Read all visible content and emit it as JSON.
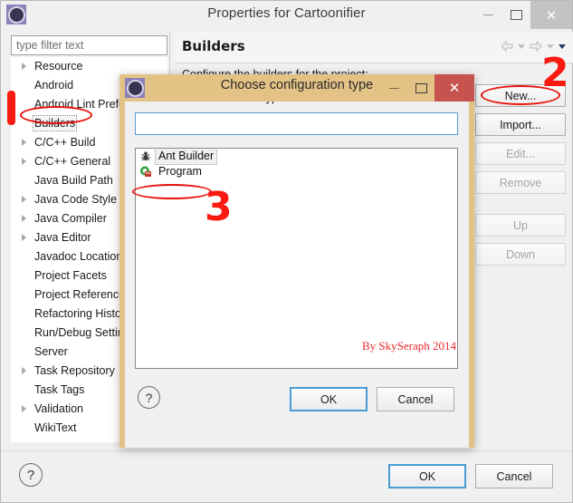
{
  "window": {
    "title": "Properties for Cartoonifier",
    "icon": "eclipse-icon",
    "minimize_label": "",
    "maximize_label": "",
    "close_label": "✕"
  },
  "sidebar": {
    "filter": {
      "placeholder": "type filter text",
      "value": "type filter text"
    },
    "items": [
      {
        "label": "Resource",
        "expandable": true,
        "selected": false
      },
      {
        "label": "Android",
        "expandable": false,
        "selected": false
      },
      {
        "label": "Android Lint Prefer",
        "expandable": false,
        "selected": false
      },
      {
        "label": "Builders",
        "expandable": false,
        "selected": true
      },
      {
        "label": "C/C++ Build",
        "expandable": true,
        "selected": false
      },
      {
        "label": "C/C++ General",
        "expandable": true,
        "selected": false
      },
      {
        "label": "Java Build Path",
        "expandable": false,
        "selected": false
      },
      {
        "label": "Java Code Style",
        "expandable": true,
        "selected": false
      },
      {
        "label": "Java Compiler",
        "expandable": true,
        "selected": false
      },
      {
        "label": "Java Editor",
        "expandable": true,
        "selected": false
      },
      {
        "label": "Javadoc Location",
        "expandable": false,
        "selected": false
      },
      {
        "label": "Project Facets",
        "expandable": false,
        "selected": false
      },
      {
        "label": "Project References",
        "expandable": false,
        "selected": false
      },
      {
        "label": "Refactoring History",
        "expandable": false,
        "selected": false
      },
      {
        "label": "Run/Debug Settings",
        "expandable": false,
        "selected": false
      },
      {
        "label": "Server",
        "expandable": false,
        "selected": false
      },
      {
        "label": "Task Repository",
        "expandable": true,
        "selected": false
      },
      {
        "label": "Task Tags",
        "expandable": false,
        "selected": false
      },
      {
        "label": "Validation",
        "expandable": true,
        "selected": false
      },
      {
        "label": "WikiText",
        "expandable": false,
        "selected": false
      }
    ]
  },
  "content": {
    "title": "Builders",
    "subtitle": "Configure the builders for the project:",
    "nav": {
      "back": "back-arrow",
      "back_menu": "chevron-down",
      "forward": "forward-arrow",
      "forward_menu": "chevron-down",
      "view_menu": "chevron-down"
    },
    "buttons": [
      {
        "label": "New...",
        "enabled": true
      },
      {
        "label": "Import...",
        "enabled": true
      },
      {
        "label": "Edit...",
        "enabled": false
      },
      {
        "label": "Remove",
        "enabled": false
      },
      {
        "label": "Up",
        "enabled": false
      },
      {
        "label": "Down",
        "enabled": false
      }
    ]
  },
  "main_footer": {
    "help": "?",
    "ok": "OK",
    "cancel": "Cancel"
  },
  "dialog": {
    "title": "Choose configuration type",
    "icon": "eclipse-icon",
    "close_label": "✕",
    "prompt": "Choose an external tool type to create:",
    "input": {
      "value": "",
      "placeholder": ""
    },
    "list": [
      {
        "label": "Ant Builder",
        "icon": "ant-icon",
        "selected": true
      },
      {
        "label": "Program",
        "icon": "program-icon",
        "selected": false
      }
    ],
    "watermark": "By SkySeraph 2014",
    "help": "?",
    "ok": "OK",
    "cancel": "Cancel"
  },
  "annotations": {
    "step2": "2",
    "step3": "3",
    "accent_color": "#fb1a12"
  }
}
